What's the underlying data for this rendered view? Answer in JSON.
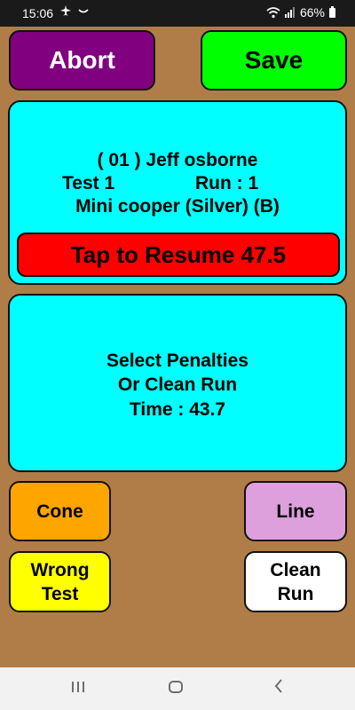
{
  "status_bar": {
    "time": "15:06",
    "battery": "66%",
    "left_icons": [
      "airplane-icon",
      "smile-icon"
    ],
    "right_icons": [
      "wifi-icon",
      "signal-icon",
      "battery-icon"
    ]
  },
  "actions": {
    "abort_label": "Abort",
    "save_label": "Save"
  },
  "driver": {
    "name_line": "( 01 ) Jeff osborne",
    "test_label": "Test  1",
    "run_label": "Run :  1",
    "car_line": "Mini cooper (Silver) (B)"
  },
  "resume": {
    "label": "Tap to Resume  47.5"
  },
  "penalties": {
    "line1": "Select Penalties",
    "line2": "Or Clean Run",
    "time_line": "Time :  43.7"
  },
  "penalty_buttons": {
    "cone": "Cone",
    "line": "Line",
    "wrong_test_line1": "Wrong",
    "wrong_test_line2": "Test",
    "clean_run_line1": "Clean",
    "clean_run_line2": "Run"
  },
  "colors": {
    "background": "#B07D48",
    "abort": "#800080",
    "save": "#00FF00",
    "panel": "#00FFFF",
    "resume": "#FF0000",
    "cone": "#FFA500",
    "line": "#DDA0DD",
    "wrong_test": "#FFFF00",
    "clean_run": "#FFFFFF"
  },
  "navigation": {
    "recents_icon": "recents-icon",
    "home_icon": "home-icon",
    "back_icon": "back-icon"
  }
}
